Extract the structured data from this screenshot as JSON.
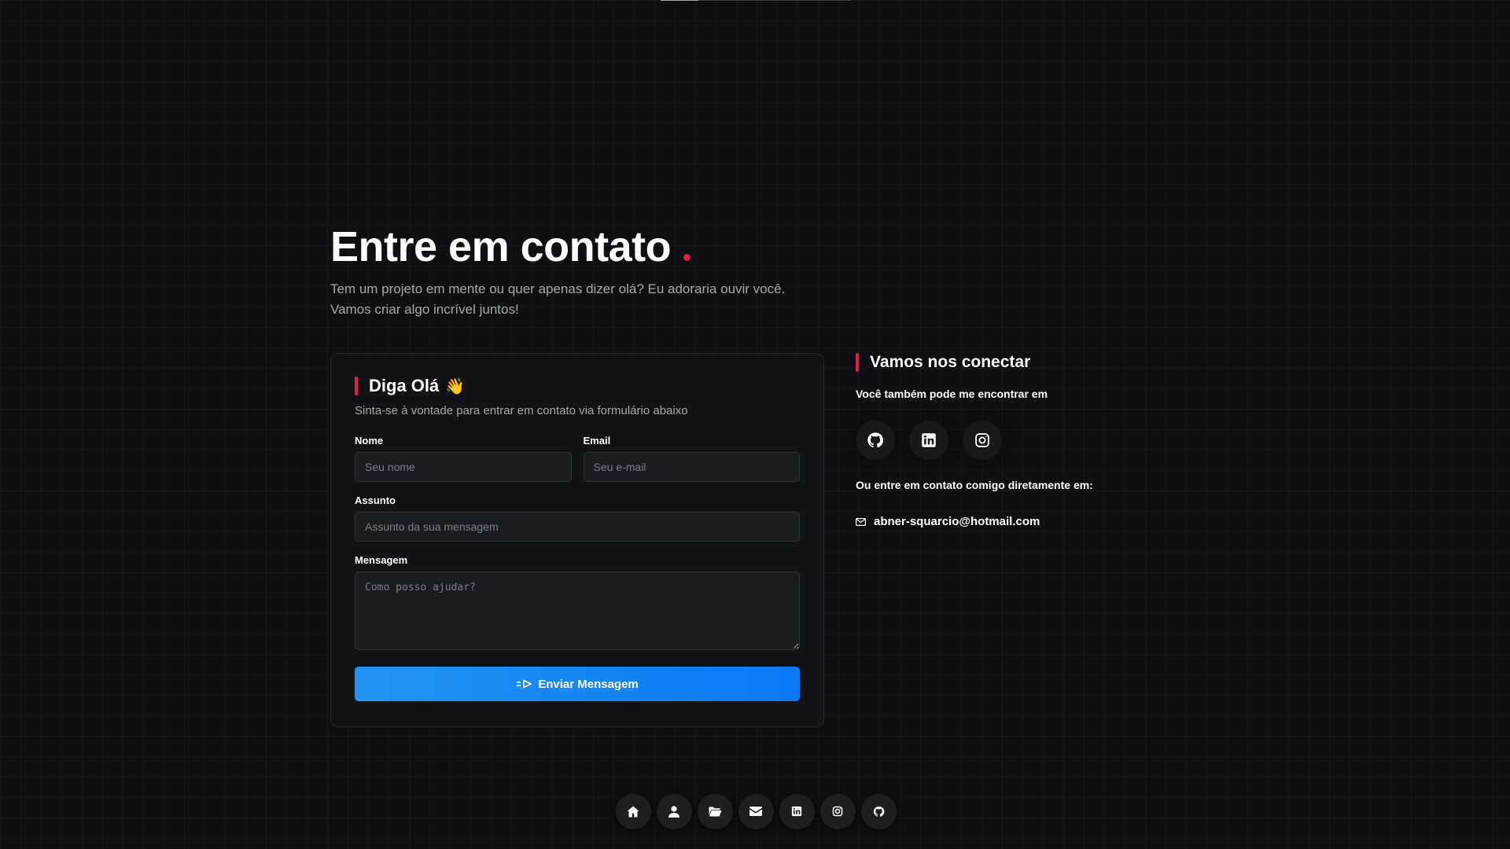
{
  "header": {
    "title": "Entre em contato",
    "subtitle_line1": "Tem um projeto em mente ou quer apenas dizer olá? Eu adoraria ouvir você.",
    "subtitle_line2": "Vamos criar algo incrível juntos!"
  },
  "form": {
    "title": "Diga Olá",
    "wave_emoji": "👋",
    "description": "Sinta-se à vontade para entrar em contato via formulário abaixo",
    "name_label": "Nome",
    "name_placeholder": "Seu nome",
    "name_value": "",
    "email_label": "Email",
    "email_placeholder": "Seu e-mail",
    "email_value": "",
    "subject_label": "Assunto",
    "subject_placeholder": "Assunto da sua mensagem",
    "subject_value": "",
    "message_label": "Mensagem",
    "message_placeholder": "Como posso ajudar?",
    "message_value": "",
    "submit_label": "Enviar Mensagem"
  },
  "connect": {
    "title": "Vamos nos conectar",
    "find_text": "Você também pode me encontrar em",
    "socials": [
      "github-icon",
      "linkedin-icon",
      "instagram-icon"
    ],
    "direct_text": "Ou entre em contato comigo diretamente em:",
    "email": "abner-squarcio@hotmail.com"
  },
  "dock": {
    "items": [
      "home-icon",
      "user-icon",
      "folder-icon",
      "mail-icon",
      "linkedin-icon",
      "instagram-icon",
      "github-icon"
    ]
  },
  "colors": {
    "background": "#0e0f12",
    "accent_red": "#e11d48",
    "button_blue": "#0a7af5",
    "card": "#121317"
  }
}
